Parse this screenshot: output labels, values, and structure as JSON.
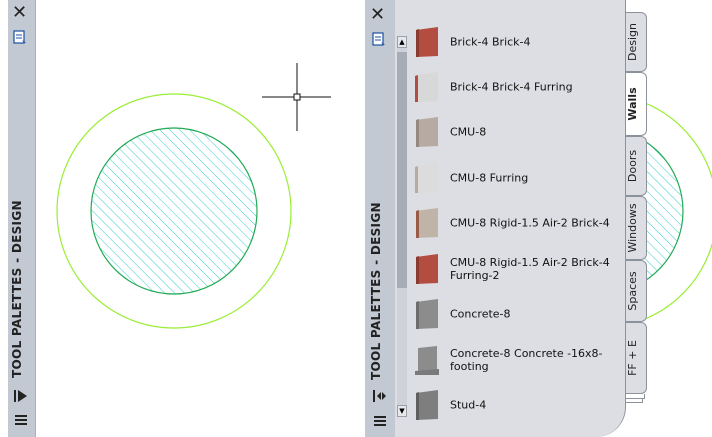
{
  "left_palette": {
    "title": "TOOL PALETTES - DESIGN"
  },
  "right_palette": {
    "title": "TOOL PALETTES - DESIGN",
    "tabs": [
      {
        "label": "Design",
        "active": false
      },
      {
        "label": "Walls",
        "active": true
      },
      {
        "label": "Doors",
        "active": false
      },
      {
        "label": "Windows",
        "active": false
      },
      {
        "label": "Spaces",
        "active": false
      },
      {
        "label": "FF + E",
        "active": false
      }
    ],
    "tools": [
      {
        "label": "Brick-4 Brick-4",
        "icon": "brick-wall-icon"
      },
      {
        "label": "Brick-4 Brick-4 Furring",
        "icon": "brick-furring-wall-icon"
      },
      {
        "label": "CMU-8",
        "icon": "cmu-wall-icon"
      },
      {
        "label": "CMU-8 Furring",
        "icon": "cmu-furring-wall-icon"
      },
      {
        "label": "CMU-8 Rigid-1.5 Air-2 Brick-4",
        "icon": "cmu-brick-wall-icon"
      },
      {
        "label": "CMU-8 Rigid-1.5 Air-2 Brick-4 Furring-2",
        "icon": "cmu-brick-furring-wall-icon"
      },
      {
        "label": "Concrete-8",
        "icon": "concrete-wall-icon"
      },
      {
        "label": "Concrete-8 Concrete -16x8-footing",
        "icon": "concrete-footing-wall-icon"
      },
      {
        "label": "Stud-4",
        "icon": "stud-wall-icon"
      }
    ]
  },
  "colors": {
    "palette_bg": "#c2c9d3",
    "panel_bg": "#dcdee3",
    "hatch": "#33cccc",
    "outer_circle": "#99ee33",
    "inner_circle_border": "#22aa55"
  }
}
